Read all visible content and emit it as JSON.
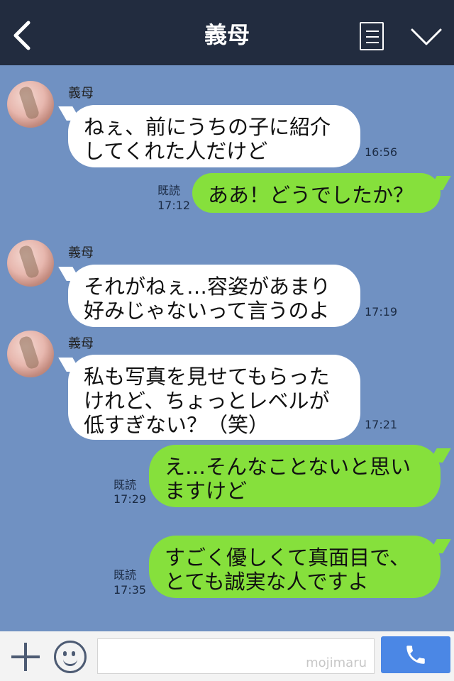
{
  "header": {
    "title": "義母"
  },
  "messages": [
    {
      "sender": "義母",
      "text": "ねぇ、前にうちの子に紹介\nしてくれた人だけど",
      "time": "16:56"
    },
    {
      "read": "既読",
      "text": "ああ！どうでしたか？",
      "time": "17:12"
    },
    {
      "sender": "義母",
      "text": "それがねぇ…容姿があまり\n好みじゃないって言うのよ",
      "time": "17:19"
    },
    {
      "sender": "義母",
      "text": "私も写真を見せてもらった\nけれど、ちょっとレベルが\n低すぎない？（笑）",
      "time": "17:21"
    },
    {
      "read": "既読",
      "text": "え…そんなことないと思い\nますけど",
      "time": "17:29"
    },
    {
      "read": "既読",
      "text": "すごく優しくて真面目で、\nとても誠実な人ですよ",
      "time": "17:35"
    }
  ],
  "input": {
    "watermark": "mojimaru"
  },
  "colors": {
    "header": "#222c3f",
    "background": "#7091c2",
    "out_bubble": "#86e03c",
    "call_button": "#4b87e5"
  },
  "icons": [
    "back-arrow-icon",
    "menu-icon",
    "chevron-down-icon",
    "plus-icon",
    "smiley-icon",
    "phone-icon"
  ]
}
